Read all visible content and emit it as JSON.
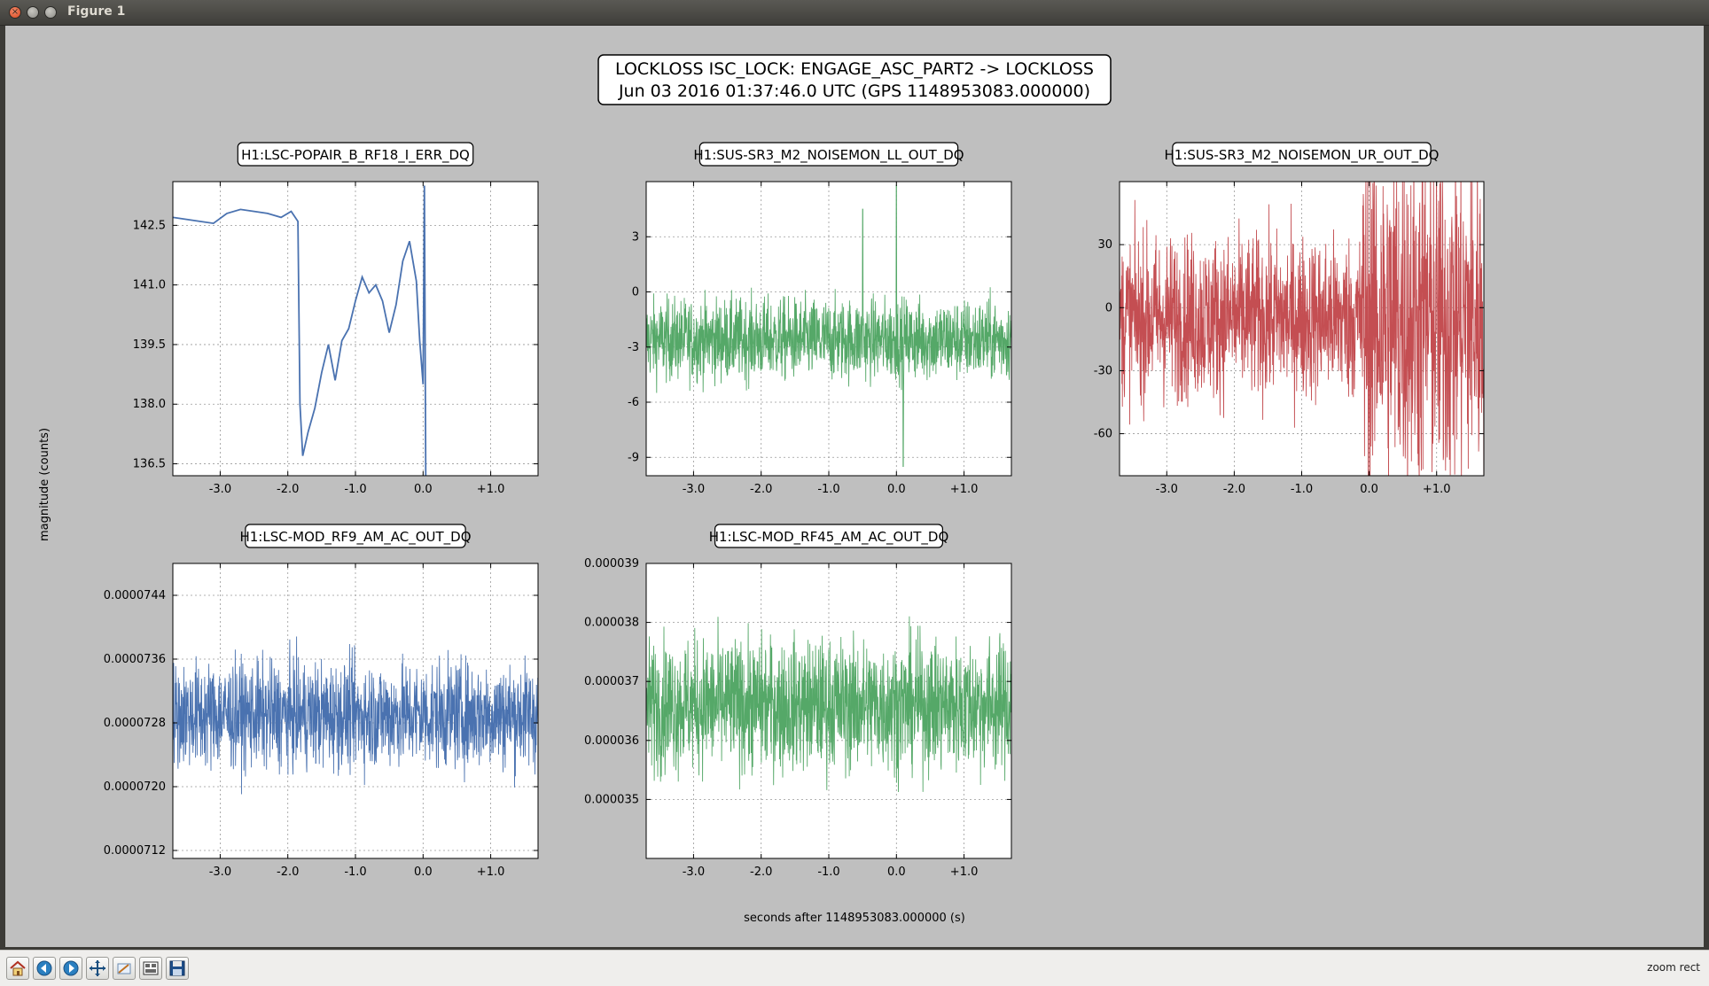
{
  "window": {
    "title": "Figure 1"
  },
  "figure": {
    "suptitle_line1": "LOCKLOSS ISC_LOCK: ENGAGE_ASC_PART2 -> LOCKLOSS",
    "suptitle_line2": "Jun 03 2016 01:37:46.0 UTC (GPS 1148953083.000000)",
    "ylabel": "magnitude (counts)",
    "xlabel": "seconds after 1148953083.000000 (s)"
  },
  "toolbar": {
    "buttons": [
      "home-icon",
      "back-icon",
      "forward-icon",
      "pan-icon",
      "zoom-icon",
      "subplots-icon",
      "save-icon"
    ],
    "status": "zoom rect"
  },
  "chart_data": [
    {
      "type": "line",
      "title": "H1:LSC-POPAIR_B_RF18_I_ERR_DQ",
      "color": "#4a72b0",
      "xlim": [
        -3.7,
        1.7
      ],
      "ylim": [
        136.2,
        143.6
      ],
      "xticks": [
        "-3.0",
        "-2.0",
        "-1.0",
        "0.0",
        "+1.0"
      ],
      "xtick_values": [
        -3.0,
        -2.0,
        -1.0,
        0.0,
        1.0
      ],
      "yticks": [
        "142.5",
        "141.0",
        "139.5",
        "138.0",
        "136.5"
      ],
      "ytick_values": [
        142.5,
        141.0,
        139.5,
        138.0,
        136.5
      ],
      "series": [
        {
          "x": [
            -3.7,
            -3.5,
            -3.3,
            -3.1,
            -2.9,
            -2.7,
            -2.5,
            -2.3,
            -2.1,
            -1.95,
            -1.85,
            -1.82,
            -1.78,
            -1.7,
            -1.6,
            -1.5,
            -1.4,
            -1.3,
            -1.2,
            -1.1,
            -1.0,
            -0.9,
            -0.8,
            -0.7,
            -0.6,
            -0.5,
            -0.4,
            -0.3,
            -0.2,
            -0.1,
            -0.05,
            0.0,
            0.02,
            0.04
          ],
          "y": [
            142.7,
            142.65,
            142.6,
            142.55,
            142.8,
            142.9,
            142.85,
            142.8,
            142.7,
            142.85,
            142.6,
            138.0,
            136.7,
            137.3,
            137.9,
            138.8,
            139.5,
            138.6,
            139.6,
            139.9,
            140.6,
            141.2,
            140.8,
            141.0,
            140.6,
            139.8,
            140.5,
            141.6,
            142.1,
            141.1,
            139.6,
            138.5,
            143.5,
            136.2
          ]
        }
      ]
    },
    {
      "type": "line",
      "title": "H1:SUS-SR3_M2_NOISEMON_LL_OUT_DQ",
      "color": "#55a868",
      "xlim": [
        -3.7,
        1.7
      ],
      "ylim": [
        -10,
        6
      ],
      "xticks": [
        "-3.0",
        "-2.0",
        "-1.0",
        "0.0",
        "+1.0"
      ],
      "xtick_values": [
        -3.0,
        -2.0,
        -1.0,
        0.0,
        1.0
      ],
      "yticks": [
        "3",
        "0",
        "-3",
        "-6",
        "-9"
      ],
      "ytick_values": [
        3,
        0,
        -3,
        -6,
        -9
      ],
      "series": [
        {
          "kind": "noise",
          "mean": -2.6,
          "amplitude": 2.0,
          "spikes": [
            [
              0.0,
              5.8
            ],
            [
              0.1,
              -9.5
            ],
            [
              -0.5,
              4.5
            ]
          ]
        }
      ]
    },
    {
      "type": "line",
      "title": "H1:SUS-SR3_M2_NOISEMON_UR_OUT_DQ",
      "color": "#c44e52",
      "xlim": [
        -3.7,
        1.7
      ],
      "ylim": [
        -80,
        60
      ],
      "xticks": [
        "-3.0",
        "-2.0",
        "-1.0",
        "0.0",
        "+1.0"
      ],
      "xtick_values": [
        -3.0,
        -2.0,
        -1.0,
        0.0,
        1.0
      ],
      "yticks": [
        "30",
        "0",
        "-30",
        "-60"
      ],
      "ytick_values": [
        30,
        0,
        -30,
        -60
      ],
      "series": [
        {
          "kind": "noise",
          "mean": -5,
          "amplitude": 35,
          "burst_from": -0.1,
          "burst_amplitude": 75
        }
      ]
    },
    {
      "type": "line",
      "title": "H1:LSC-MOD_RF9_AM_AC_OUT_DQ",
      "color": "#4a72b0",
      "xlim": [
        -3.7,
        1.7
      ],
      "ylim": [
        7.11e-05,
        7.48e-05
      ],
      "xticks": [
        "-3.0",
        "-2.0",
        "-1.0",
        "0.0",
        "+1.0"
      ],
      "xtick_values": [
        -3.0,
        -2.0,
        -1.0,
        0.0,
        1.0
      ],
      "yticks": [
        "0.0000744",
        "0.0000736",
        "0.0000728",
        "0.0000720",
        "0.0000712"
      ],
      "ytick_values": [
        7.44e-05,
        7.36e-05,
        7.28e-05,
        7.2e-05,
        7.12e-05
      ],
      "series": [
        {
          "kind": "noise",
          "mean": 7.29e-05,
          "amplitude": 6e-07
        }
      ]
    },
    {
      "type": "line",
      "title": "H1:LSC-MOD_RF45_AM_AC_OUT_DQ",
      "color": "#55a868",
      "xlim": [
        -3.7,
        1.7
      ],
      "ylim": [
        3.4e-05,
        3.9e-05
      ],
      "xticks": [
        "-3.0",
        "-2.0",
        "-1.0",
        "0.0",
        "+1.0"
      ],
      "xtick_values": [
        -3.0,
        -2.0,
        -1.0,
        0.0,
        1.0
      ],
      "yticks": [
        "0.000039",
        "0.000038",
        "0.000037",
        "0.000036",
        "0.000035"
      ],
      "ytick_values": [
        3.9e-05,
        3.8e-05,
        3.7e-05,
        3.6e-05,
        3.5e-05
      ],
      "series": [
        {
          "kind": "noise",
          "mean": 3.66e-05,
          "amplitude": 1e-06
        }
      ]
    }
  ]
}
